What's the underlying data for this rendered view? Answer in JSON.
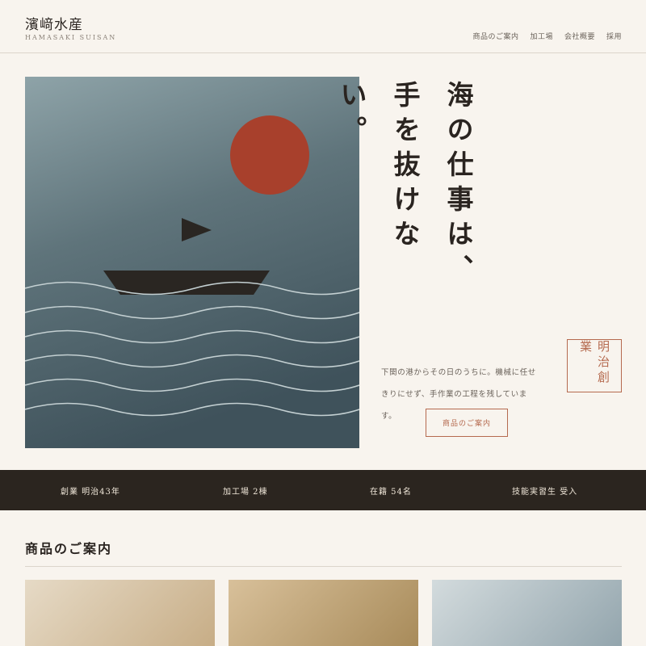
{
  "header": {
    "logo_title": "濱﨑水産",
    "logo_sub": "HAMASAKI SUISAN",
    "nav": [
      "商品のご案内",
      "加工場",
      "会社概要",
      "採用"
    ]
  },
  "hero": {
    "heading": "海の仕事は、手を抜けない。",
    "seal": "明治創業",
    "text": "下関の港からその日のうちに。機械に任せきりにせず、手作業の工程を残しています。",
    "button_label": "商品のご案内"
  },
  "stats": [
    "創業 明治43年",
    "加工場 2棟",
    "在籍 54名",
    "技能実習生 受入"
  ],
  "section": {
    "title": "商品のご案内"
  },
  "colors": {
    "background": "#f8f4ee",
    "accent": "#b56a4f",
    "dark_band": "#2b251f",
    "sun": "#a8402c",
    "sea": "#52656d"
  }
}
